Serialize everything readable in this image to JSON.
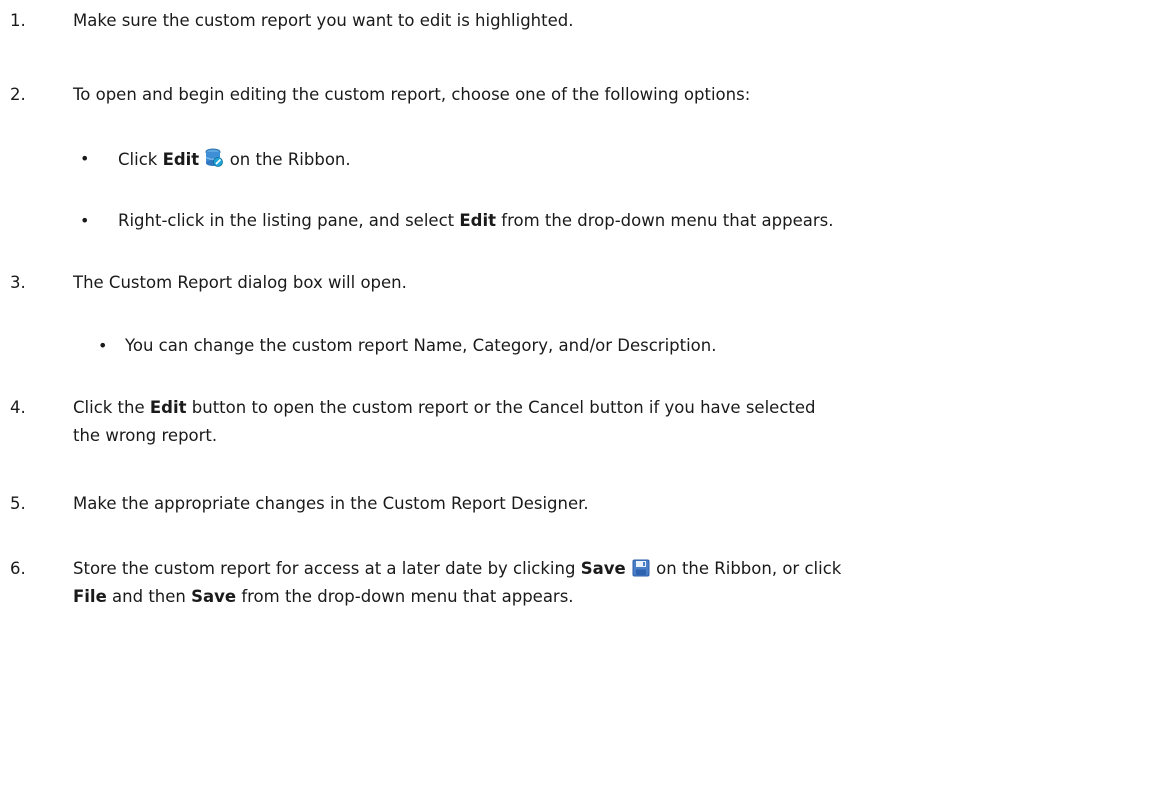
{
  "steps": [
    {
      "number": "1.",
      "text": "Make sure the custom report you want to edit is highlighted."
    },
    {
      "number": "2.",
      "text": "To open and begin editing the custom report, choose one of the following options:",
      "bullets": [
        {
          "prefix": "Click ",
          "bold": "Edit",
          "icon": "database-edit-icon",
          "suffix": " on the Ribbon."
        },
        {
          "prefix": "Right-click in the listing pane, and select ",
          "bold": "Edit",
          "suffix": " from the drop-down menu that appears."
        }
      ]
    },
    {
      "number": "3.",
      "text": "The Custom Report dialog box will open.",
      "bullets": [
        {
          "text": "You can change the custom report Name, Category, and/or Description."
        }
      ]
    },
    {
      "number": "4.",
      "prefix": "Click the ",
      "bold": "Edit",
      "suffix_line1": " button to open the custom report or the Cancel button if you have selected",
      "line2": "the wrong report."
    },
    {
      "number": "5.",
      "text": "Make the appropriate changes in the Custom Report Designer."
    },
    {
      "number": "6.",
      "prefix": "Store the custom report for access at a later date by clicking ",
      "bold": "Save",
      "icon": "floppy-disk-save-icon",
      "suffix_line1": " on the Ribbon, or click",
      "line2_bold1": "File",
      "line2_mid": " and then ",
      "line2_bold2": "Save",
      "line2_suffix": " from the drop-down menu that appears."
    }
  ]
}
